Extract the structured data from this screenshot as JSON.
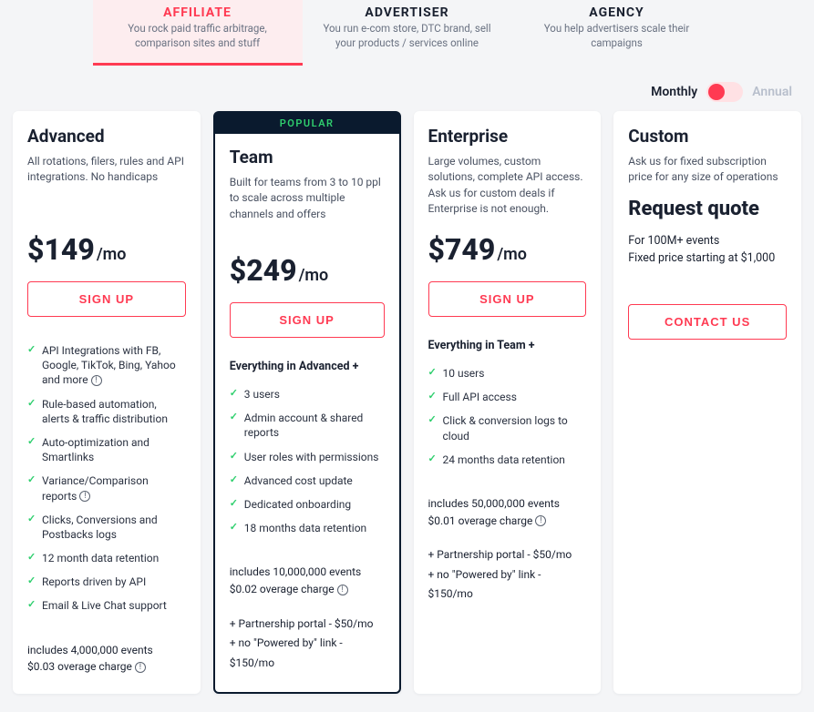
{
  "tabs": [
    {
      "title": "AFFILIATE",
      "sub": "You rock paid traffic arbitrage, comparison sites and stuff"
    },
    {
      "title": "ADVERTISER",
      "sub": "You run e-com store, DTC brand, sell your products / services online"
    },
    {
      "title": "AGENCY",
      "sub": "You help advertisers scale their campaigns"
    }
  ],
  "billing": {
    "monthly": "Monthly",
    "annual": "Annual"
  },
  "common": {
    "signup": "SIGN UP",
    "contact": "CONTACT US",
    "popular": "POPULAR"
  },
  "plans": {
    "advanced": {
      "name": "Advanced",
      "desc": "All rotations, filers, rules and API integrations. No handicaps",
      "price": "$149",
      "per": "/mo",
      "features": [
        "API Integrations with FB, Google, TikTok, Bing, Yahoo and more",
        "Rule-based automation, alerts & traffic distribution",
        "Auto-optimization and Smartlinks",
        "Variance/Comparison reports",
        "Clicks, Conversions and Postbacks logs",
        "12 month data retention",
        "Reports driven by API",
        "Email & Live Chat support"
      ],
      "includes1": "includes 4,000,000 events",
      "includes2": "$0.03 overage charge"
    },
    "team": {
      "name": "Team",
      "desc": "Built for teams from 3 to 10 ppl to scale across multiple channels and offers",
      "price": "$249",
      "per": "/mo",
      "lead": "Everything in Advanced +",
      "features": [
        "3 users",
        "Admin account & shared reports",
        "User roles with permissions",
        "Advanced cost update",
        "Dedicated onboarding",
        "18 months data retention"
      ],
      "includes1": "includes 10,000,000 events",
      "includes2": "$0.02 overage charge",
      "addon1": "+ Partnership portal - $50/mo",
      "addon2": "+ no \"Powered by\" link - $150/mo"
    },
    "enterprise": {
      "name": "Enterprise",
      "desc": "Large volumes, custom solutions, complete API access. Ask us for custom deals if Enterprise is not enough.",
      "price": "$749",
      "per": "/mo",
      "lead": "Everything in Team +",
      "features": [
        "10 users",
        "Full API access",
        "Click & conversion logs to cloud",
        "24 months data retention"
      ],
      "includes1": "includes 50,000,000 events",
      "includes2": "$0.01 overage charge",
      "addon1": "+ Partnership portal - $50/mo",
      "addon2": "+ no \"Powered by\" link - $150/mo"
    },
    "custom": {
      "name": "Custom",
      "desc": "Ask us for fixed subscription price for any size of operations",
      "quote": "Request quote",
      "sub1": "For 100M+ events",
      "sub2": "Fixed price starting at $1,000"
    }
  }
}
